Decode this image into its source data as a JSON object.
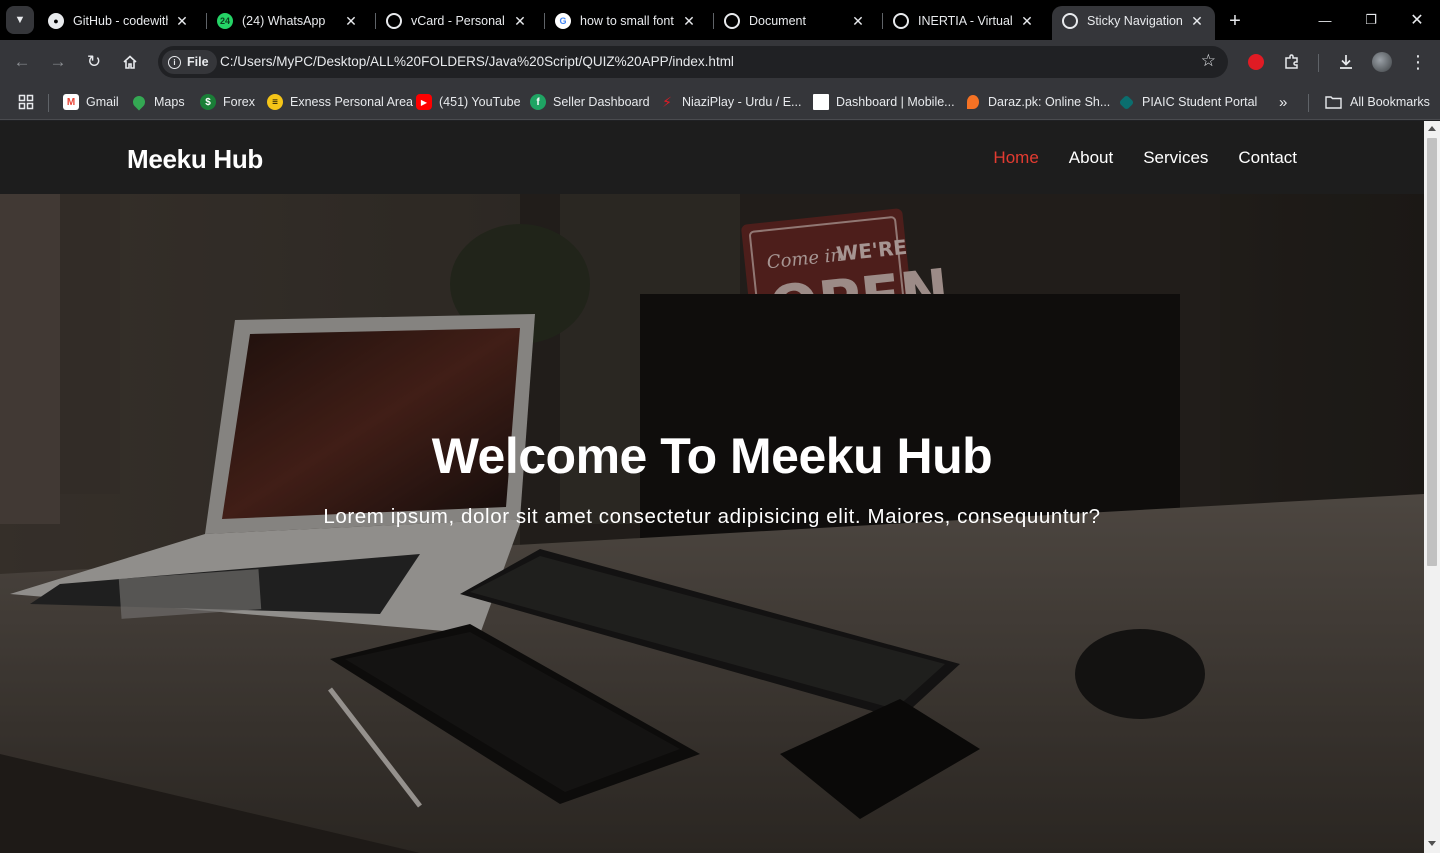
{
  "browser": {
    "tabs": [
      {
        "title": "GitHub - codewith",
        "icon": "github-icon"
      },
      {
        "title": "(24) WhatsApp",
        "icon": "whatsapp-icon",
        "badge": "24"
      },
      {
        "title": "vCard - Personal P",
        "icon": "globe-icon"
      },
      {
        "title": "how to small font",
        "icon": "google-icon"
      },
      {
        "title": "Document",
        "icon": "globe-icon"
      },
      {
        "title": "INERTIA - Virtual A",
        "icon": "globe-icon"
      },
      {
        "title": "Sticky Navigation",
        "icon": "globe-icon",
        "active": true
      }
    ],
    "address_bar": {
      "chip_label": "File",
      "url": "C:/Users/MyPC/Desktop/ALL%20FOLDERS/Java%20Script/QUIZ%20APP/index.html"
    },
    "bookmarks": [
      {
        "label": "Gmail",
        "icon": "gmail-icon"
      },
      {
        "label": "Maps",
        "icon": "maps-icon"
      },
      {
        "label": "Forex",
        "icon": "dollar-icon"
      },
      {
        "label": "Exness Personal Area",
        "icon": "exness-icon"
      },
      {
        "label": "(451) YouTube",
        "icon": "youtube-icon"
      },
      {
        "label": "Seller Dashboard",
        "icon": "seller-icon"
      },
      {
        "label": "NiaziPlay - Urdu / E...",
        "icon": "niaziplay-icon"
      },
      {
        "label": "Dashboard | Mobile...",
        "icon": "page-icon"
      },
      {
        "label": "Daraz.pk: Online Sh...",
        "icon": "daraz-icon"
      },
      {
        "label": "PIAIC Student Portal",
        "icon": "piaic-icon"
      }
    ],
    "bookmarks_overflow": "»",
    "all_bookmarks_label": "All Bookmarks"
  },
  "page": {
    "logo": "Meeku Hub",
    "nav": [
      {
        "label": "Home",
        "active": true
      },
      {
        "label": "About"
      },
      {
        "label": "Services"
      },
      {
        "label": "Contact"
      }
    ],
    "hero": {
      "title": "Welcome To Meeku Hub",
      "subtitle": "Lorem ipsum, dolor sit amet consectetur adipisicing elit. Maiores, consequuntur?"
    },
    "photo_sign": {
      "line1": "Come in",
      "line2": "WE'RE",
      "line3": "OPEN"
    }
  },
  "colors": {
    "nav_active": "#e33b31",
    "navbar_bg": "#1d1d1d"
  }
}
